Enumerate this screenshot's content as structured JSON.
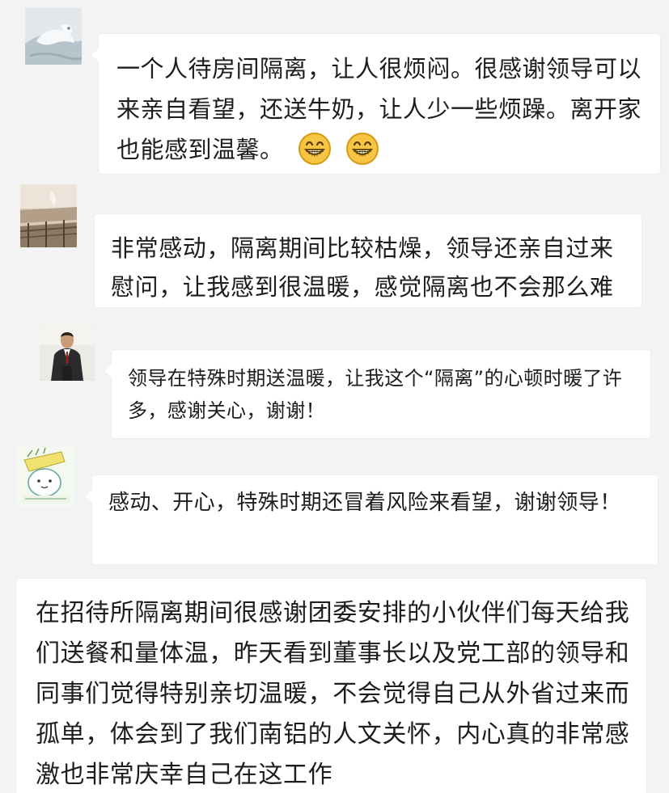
{
  "messages": [
    {
      "text": "一个人待房间隔离，让人很烦闷。很感谢领导可以来亲自看望，还送牛奶，让人少一些烦躁。离开家也能感到温馨。",
      "emoji_icons": [
        "grinning-face-icon",
        "grinning-face-icon"
      ]
    },
    {
      "text": "非常感动，隔离期间比较枯燥，领导还亲自过来慰问，让我感到很温暖，感觉隔离也不会那么难受了"
    },
    {
      "text": "领导在特殊时期送温暖，让我这个“隔离”的心顿时暖了许多，感谢关心，谢谢！"
    },
    {
      "text": "感动、开心，特殊时期还冒着风险来看望，谢谢领导！"
    },
    {
      "text": "在招待所隔离期间很感谢团委安排的小伙伴们每天给我们送餐和量体温，昨天看到董事长以及党工部的领导和同事们觉得特别亲切温暖，不会觉得自己从外省过来而孤单，体会到了我们南铝的人文关怀，内心真的非常感激也非常庆幸自己在这工作"
    }
  ],
  "colors": {
    "background": "#f3f3f3",
    "bubble": "#ffffff",
    "text": "#1d1d1d",
    "emoji_face": "#f6c544"
  }
}
